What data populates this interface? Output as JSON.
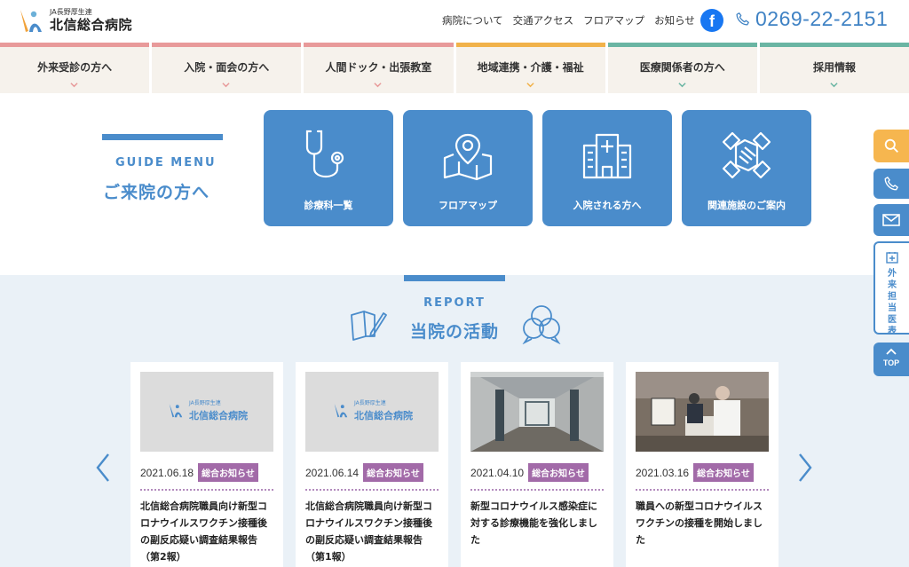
{
  "header": {
    "logo_sub": "JA長野厚生連",
    "logo_main": "北信総合病院",
    "links": [
      "病院について",
      "交通アクセス",
      "フロアマップ",
      "お知らせ"
    ],
    "phone": "0269-22-2151"
  },
  "nav": {
    "items": [
      {
        "label": "外来受診の方へ",
        "color": "#e89a9a"
      },
      {
        "label": "入院・面会の方へ",
        "color": "#e89a9a"
      },
      {
        "label": "人間ドック・出張教室",
        "color": "#e89a9a"
      },
      {
        "label": "地域連携・介護・福祉",
        "color": "#f1b24a"
      },
      {
        "label": "医療関係者の方へ",
        "color": "#6ab5a3"
      },
      {
        "label": "採用情報",
        "color": "#6ab5a3"
      }
    ]
  },
  "guide": {
    "en": "GUIDE MENU",
    "jp": "ご来院の方へ",
    "cards": [
      {
        "label": "診療科一覧",
        "icon": "stethoscope-icon"
      },
      {
        "label": "フロアマップ",
        "icon": "map-pin-icon"
      },
      {
        "label": "入院される方へ",
        "icon": "hospital-building-icon"
      },
      {
        "label": "関連施設のご案内",
        "icon": "handshake-icon"
      }
    ]
  },
  "report": {
    "en": "REPORT",
    "jp": "当院の活動",
    "news": [
      {
        "date": "2021.06.18",
        "category": "総合お知らせ",
        "title": "北信総合病院職員向け新型コロナウイルスワクチン接種後の副反応疑い調査結果報告（第2報）",
        "thumb": "logo"
      },
      {
        "date": "2021.06.14",
        "category": "総合お知らせ",
        "title": "北信総合病院職員向け新型コロナウイルスワクチン接種後の副反応疑い調査結果報告（第1報）",
        "thumb": "logo"
      },
      {
        "date": "2021.04.10",
        "category": "総合お知らせ",
        "title": "新型コロナウイルス感染症に対する診療機能を強化しました",
        "thumb": "corridor"
      },
      {
        "date": "2021.03.16",
        "category": "総合お知らせ",
        "title": "職員への新型コロナウイルスワクチンの接種を開始しました",
        "thumb": "vaccine"
      }
    ]
  },
  "side": {
    "schedule": "外来担当医表",
    "top": "TOP"
  }
}
